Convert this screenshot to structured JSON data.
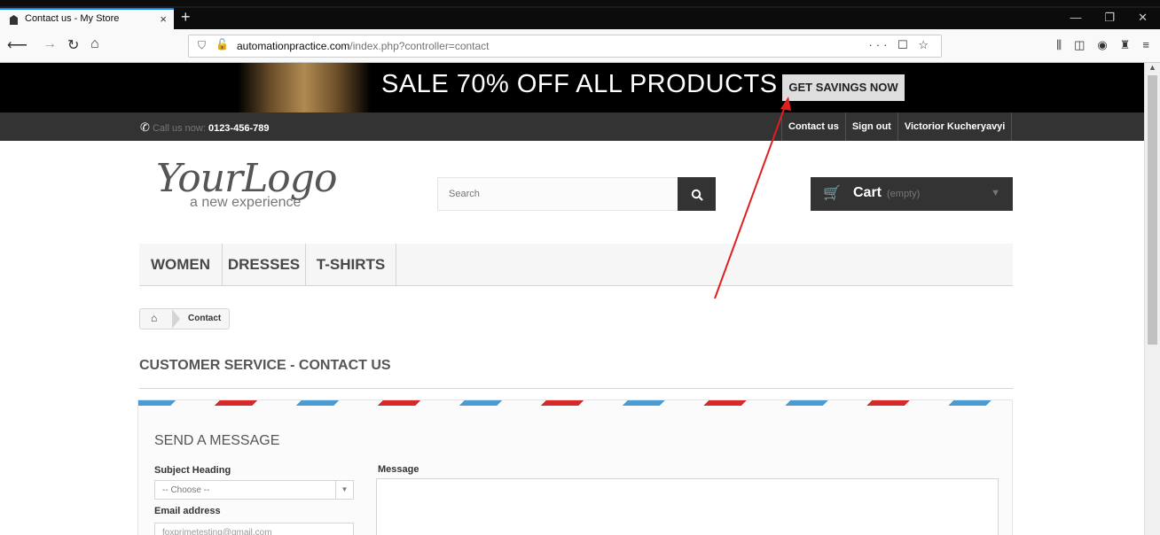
{
  "browser": {
    "tab_title": "Contact us - My Store",
    "tab_close": "×",
    "new_tab": "+",
    "url_host": "automationpractice.com",
    "url_path": "/index.php?controller=contact",
    "url_actions": "··· ☐ ☆"
  },
  "banner": {
    "sale_text": "SALE 70% OFF ALL PRODUCTS",
    "savings_button": "GET SAVINGS NOW"
  },
  "topbar": {
    "call_label": "Call us now:",
    "phone": "0123-456-789",
    "contact_link": "Contact us",
    "signout_link": "Sign out",
    "user_name": "Victorior Kucheryavyi"
  },
  "logo": {
    "main": "YourLogo",
    "tagline": "a new experience"
  },
  "search": {
    "placeholder": "Search"
  },
  "cart": {
    "label": "Cart",
    "status": "(empty)"
  },
  "menu": {
    "items": [
      "WOMEN",
      "DRESSES",
      "T-SHIRTS"
    ]
  },
  "breadcrumb": {
    "current": "Contact"
  },
  "page": {
    "heading": "CUSTOMER SERVICE - CONTACT US"
  },
  "form": {
    "title": "SEND A MESSAGE",
    "subject_label": "Subject Heading",
    "subject_value": "-- Choose --",
    "email_label": "Email address",
    "email_value": "foxprimetesting@gmail.com",
    "message_label": "Message"
  },
  "colors": {
    "annotation_arrow": "#e01f1f"
  }
}
